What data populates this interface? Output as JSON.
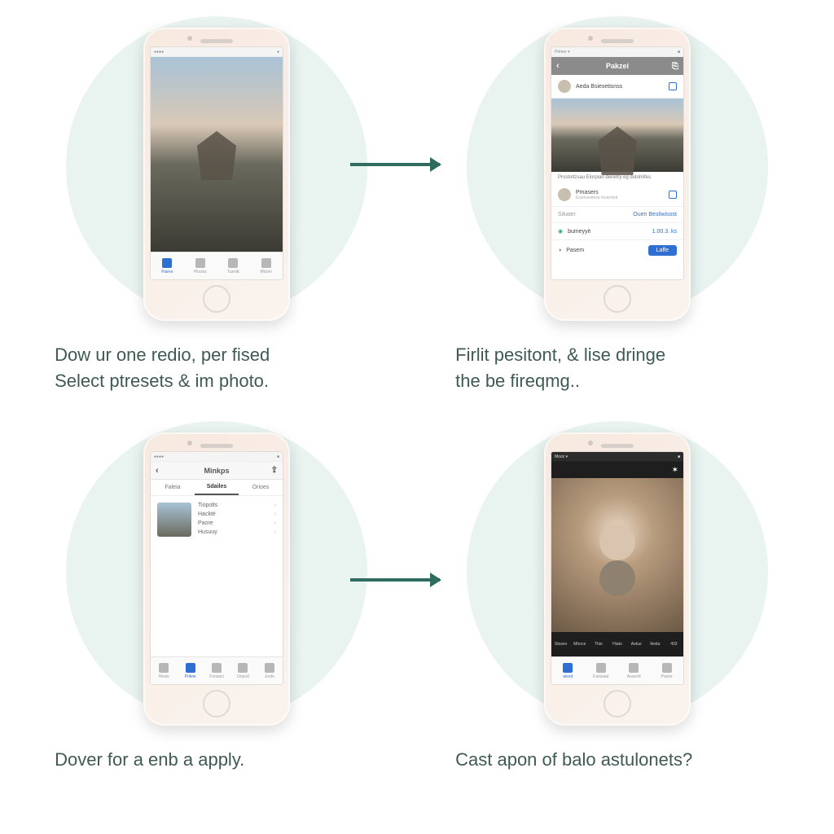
{
  "steps": [
    {
      "caption_line1": "Dow ur one redio, per fised",
      "caption_line2": "Select ptresets & im photo.",
      "phone": {
        "tabbar": [
          "Flares",
          "Pluviss",
          "Tuesitt",
          "Miclen"
        ]
      }
    },
    {
      "caption_line1": "Firlit pesitont, & lise dringe",
      "caption_line2": "the be fireqmg..",
      "phone": {
        "header_title": "Pakzei",
        "user_row": "Aeda Bsiesetisnss",
        "meta_line": "Prostoltzsau Elorpian denetry eg dutohlifes",
        "second_user": "Pmasers",
        "second_sub": "Essmsestese fosarstyd",
        "footer_label": "Sikater",
        "footer_right": "Ouen Besliwisost",
        "row_left1": "bumeyyit",
        "row_right1": "1.00.3. ks",
        "row_left2": "Pasem",
        "btn": "Laffe"
      }
    },
    {
      "caption_line1": "Dover for a enb a apply.",
      "phone": {
        "header_title": "Minkps",
        "seg": [
          "Faleia",
          "Sdailes",
          "Orioes"
        ],
        "list": [
          "Tiopolts",
          "Hackté",
          "Paore",
          "Husuuy"
        ],
        "tabbar": [
          "Hests",
          "Prilew",
          "Foosaci",
          "Unpod",
          "Jords"
        ]
      }
    },
    {
      "caption_line1": "Cast apon of balo astulonets?",
      "phone": {
        "filters": [
          "Stoses",
          "Mtroce",
          "Thio",
          "Hiato",
          "Aetus",
          "Ikeita",
          "403"
        ],
        "tabbar": [
          "alsod",
          "Farssaat",
          "Ausentt",
          "Pazier"
        ]
      }
    }
  ]
}
